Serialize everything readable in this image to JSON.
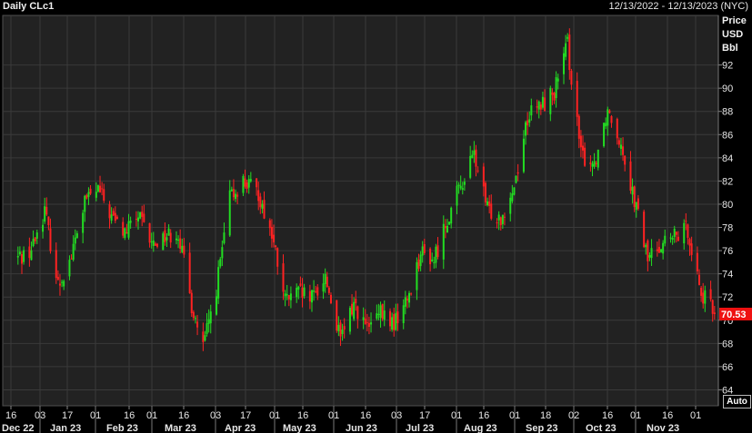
{
  "title": "Daily CLc1",
  "date_range": "12/13/2022 - 12/13/2023 (NYC)",
  "axis_header": [
    "Price",
    "USD",
    "Bbl"
  ],
  "auto_label": "Auto",
  "colors": {
    "up": "#22dd22",
    "down": "#ff2222",
    "grid": "#3a3a3a",
    "plot_bg": "#222222",
    "last_price_bg": "#ee1111"
  },
  "chart_data": {
    "type": "candlestick",
    "title": "Daily CLc1",
    "ylabel": "Price USD Bbl",
    "ylim": [
      62.5,
      94.5
    ],
    "y_ticks": [
      64,
      66,
      68,
      70,
      72,
      74,
      76,
      78,
      80,
      82,
      84,
      86,
      88,
      90,
      92
    ],
    "last_price": 70.53,
    "grid": true,
    "x_day_ticks": [
      "16",
      "03",
      "17",
      "01",
      "16",
      "01",
      "16",
      "03",
      "17",
      "01",
      "16",
      "01",
      "16",
      "03",
      "17",
      "01",
      "16",
      "01",
      "18",
      "02",
      "16",
      "01",
      "16",
      "01"
    ],
    "x_month_labels": [
      "Dec 22",
      "Jan 23",
      "Feb 23",
      "Mar 23",
      "Apr 23",
      "May 23",
      "Jun 23",
      "Jul 23",
      "Aug 23",
      "Sep 23",
      "Oct 23",
      "Nov 23"
    ],
    "series": [
      {
        "name": "CLc1",
        "close_path": [
          [
            "2022-12-13",
            75.4
          ],
          [
            "2022-12-20",
            76.1
          ],
          [
            "2022-12-27",
            79.5
          ],
          [
            "2023-01-03",
            73.0
          ],
          [
            "2023-01-10",
            75.5
          ],
          [
            "2023-01-17",
            80.2
          ],
          [
            "2023-01-24",
            81.3
          ],
          [
            "2023-01-31",
            78.9
          ],
          [
            "2023-02-07",
            77.5
          ],
          [
            "2023-02-14",
            79.0
          ],
          [
            "2023-02-21",
            76.5
          ],
          [
            "2023-02-28",
            77.3
          ],
          [
            "2023-03-07",
            77.6
          ],
          [
            "2023-03-14",
            71.3
          ],
          [
            "2023-03-20",
            67.6
          ],
          [
            "2023-03-27",
            72.8
          ],
          [
            "2023-04-03",
            80.5
          ],
          [
            "2023-04-10",
            82.0
          ],
          [
            "2023-04-18",
            80.9
          ],
          [
            "2023-04-25",
            77.3
          ],
          [
            "2023-05-02",
            71.7
          ],
          [
            "2023-05-09",
            72.3
          ],
          [
            "2023-05-16",
            71.8
          ],
          [
            "2023-05-23",
            73.8
          ],
          [
            "2023-05-31",
            68.2
          ],
          [
            "2023-06-07",
            71.5
          ],
          [
            "2023-06-14",
            69.2
          ],
          [
            "2023-06-21",
            70.5
          ],
          [
            "2023-06-28",
            69.7
          ],
          [
            "2023-07-05",
            71.8
          ],
          [
            "2023-07-12",
            75.8
          ],
          [
            "2023-07-19",
            75.2
          ],
          [
            "2023-07-26",
            78.8
          ],
          [
            "2023-08-02",
            81.6
          ],
          [
            "2023-08-09",
            84.3
          ],
          [
            "2023-08-16",
            79.5
          ],
          [
            "2023-08-23",
            78.9
          ],
          [
            "2023-08-30",
            81.6
          ],
          [
            "2023-09-06",
            87.5
          ],
          [
            "2023-09-13",
            88.5
          ],
          [
            "2023-09-20",
            89.7
          ],
          [
            "2023-09-27",
            93.7
          ],
          [
            "2023-10-04",
            84.2
          ],
          [
            "2023-10-11",
            83.5
          ],
          [
            "2023-10-18",
            88.3
          ],
          [
            "2023-10-25",
            85.4
          ],
          [
            "2023-11-01",
            80.4
          ],
          [
            "2023-11-08",
            75.3
          ],
          [
            "2023-11-15",
            76.7
          ],
          [
            "2023-11-22",
            77.1
          ],
          [
            "2023-11-29",
            77.9
          ],
          [
            "2023-12-06",
            72.3
          ],
          [
            "2023-12-13",
            70.53
          ]
        ]
      }
    ]
  }
}
